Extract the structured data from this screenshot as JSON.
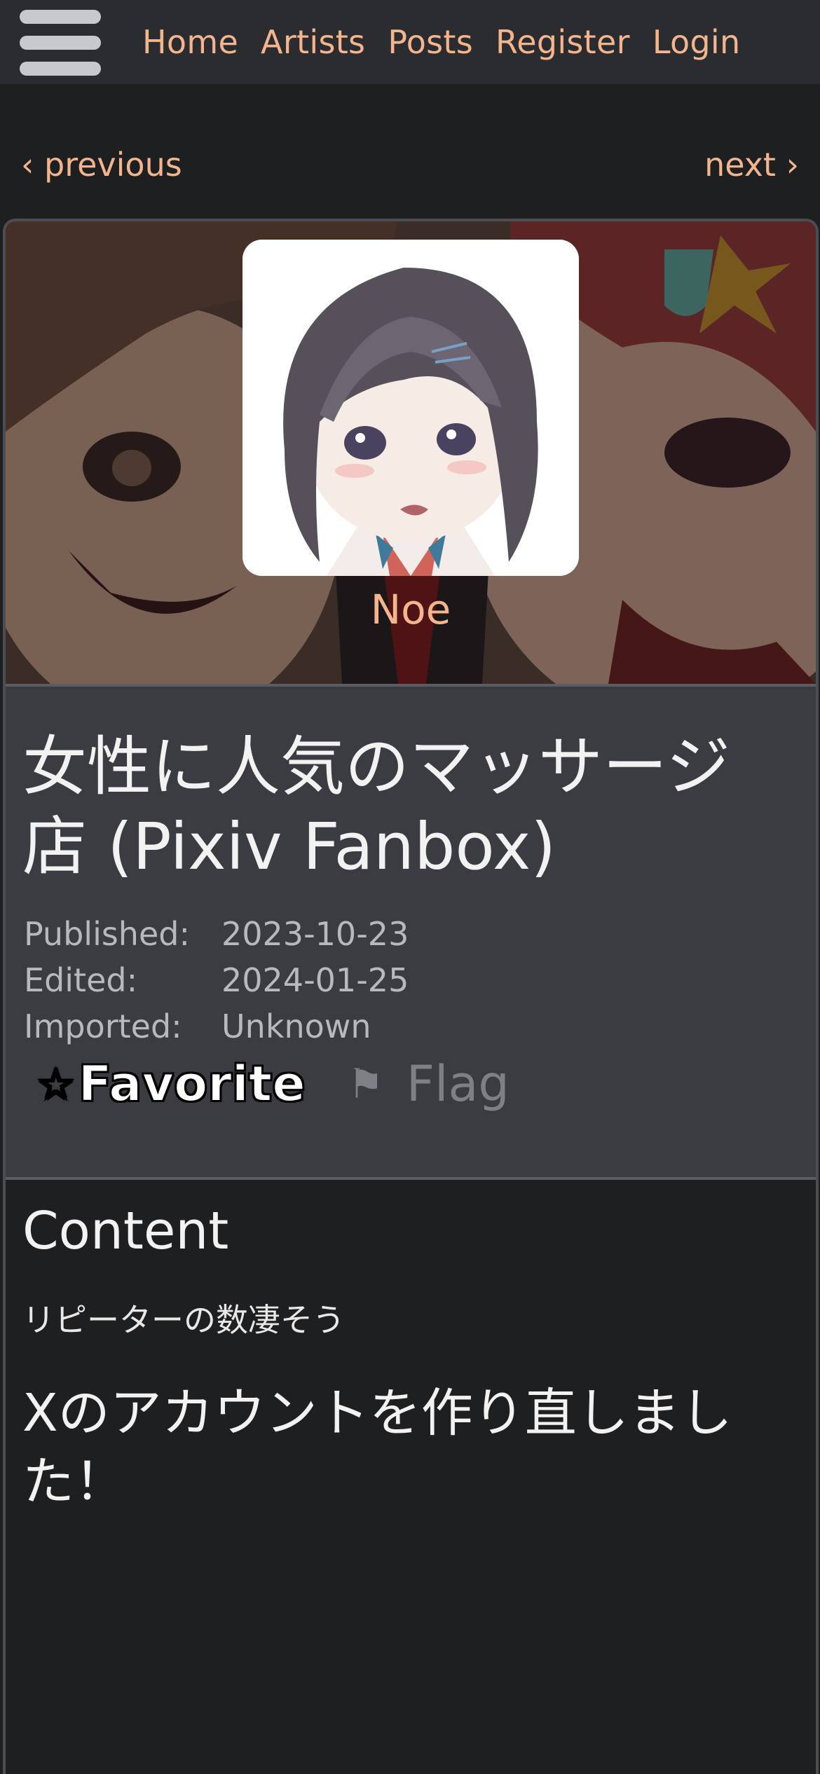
{
  "nav": {
    "menu_icon": "hamburger-menu-icon",
    "links": [
      "Home",
      "Artists",
      "Posts",
      "Register",
      "Login"
    ]
  },
  "pager": {
    "previous": "‹ previous",
    "next": "next ›"
  },
  "artist": {
    "name": "Noe"
  },
  "post": {
    "title": "女性に人気のマッサージ店 (Pixiv Fanbox)",
    "meta": [
      {
        "key": "Published:",
        "value": "2023-10-23"
      },
      {
        "key": "Edited:",
        "value": "2024-01-25"
      },
      {
        "key": "Imported:",
        "value": "Unknown"
      }
    ],
    "favorite_label": "Favorite",
    "favorite_icon": "star-outline-icon",
    "flag_label": "Flag",
    "flag_icon": "flag-icon"
  },
  "content": {
    "heading": "Content",
    "line1": "リピーターの数凄そう",
    "line2": "Xのアカウントを作り直しました！"
  },
  "colors": {
    "accent": "#f2b58e",
    "background": "#1e1f21",
    "info_panel": "#3a3c42"
  }
}
